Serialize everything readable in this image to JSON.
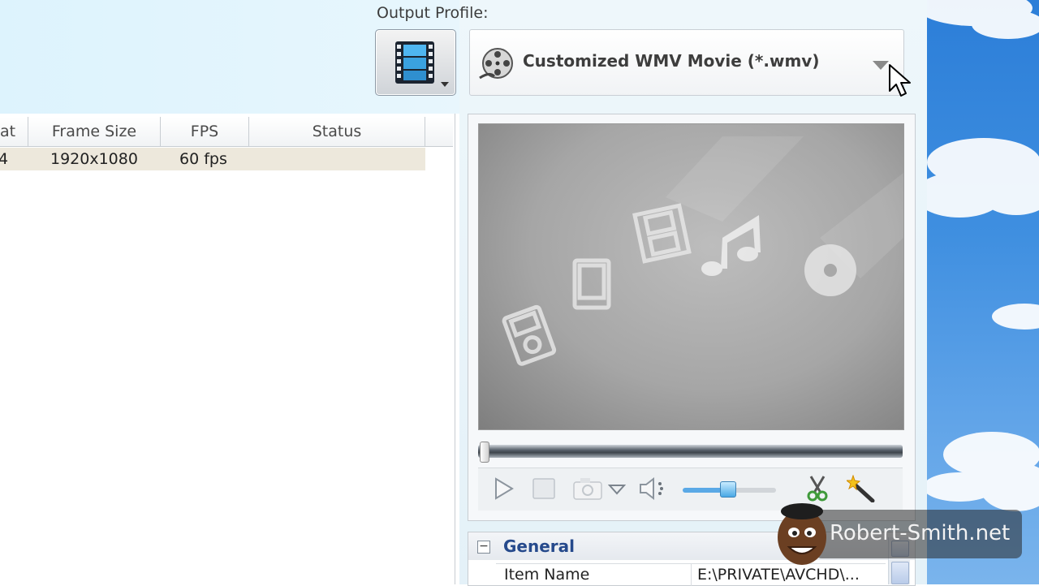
{
  "output_profile": {
    "label": "Output Profile:",
    "selected": "Customized WMV Movie (*.wmv)"
  },
  "file_list": {
    "columns": [
      "at",
      "Frame Size",
      "FPS",
      "Status"
    ],
    "rows": [
      {
        "format": "4",
        "frame_size": "1920x1080",
        "fps": "60 fps",
        "status": ""
      }
    ]
  },
  "preview": {
    "seek_position": 0,
    "volume_level": 0.5
  },
  "properties": {
    "section": "General",
    "collapse_symbol": "−",
    "rows": [
      {
        "key": "Item Name",
        "value": "E:\\PRIVATE\\AVCHD\\..."
      }
    ]
  },
  "watermark": {
    "text": "Robert-Smith.net"
  },
  "icons": {
    "profile": "film-strip-icon",
    "format": "film-reel-icon",
    "play": "play-icon",
    "stop": "stop-icon",
    "snapshot": "camera-icon",
    "volume": "speaker-icon",
    "clip": "scissors-icon",
    "effect": "magic-wand-icon"
  },
  "colors": {
    "section_title": "#264a8c",
    "volume_fill": "#5aa9e6",
    "sky": "#3f8fe0"
  }
}
